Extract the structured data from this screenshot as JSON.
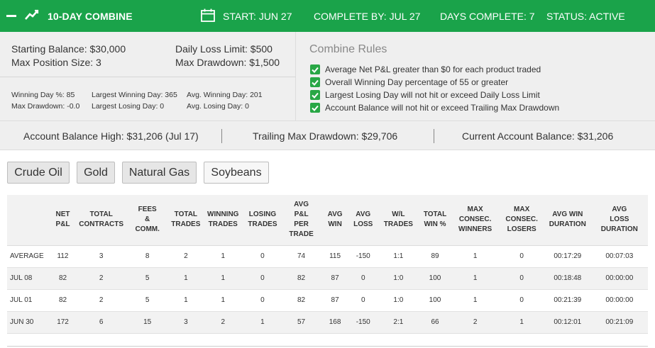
{
  "header": {
    "title": "10-DAY COMBINE",
    "start": "START: JUN 27",
    "complete_by": "COMPLETE BY: JUL 27",
    "days_complete": "DAYS COMPLETE: 7",
    "status": "STATUS: ACTIVE",
    "accent_color": "#1aa34a"
  },
  "summary": {
    "starting_balance": "Starting Balance: $30,000",
    "max_position_size": "Max Position Size: 3",
    "daily_loss_limit": "Daily Loss Limit: $500",
    "max_drawdown": "Max Drawdown: $1,500",
    "winning_day_pct": "Winning Day %: 85",
    "max_drawdown_small": "Max Drawdown: -0.0",
    "largest_winning_day": "Largest Winning Day: 365",
    "largest_losing_day": "Largest Losing Day: 0",
    "avg_winning_day": "Avg. Winning Day: 201",
    "avg_losing_day": "Avg. Losing Day: 0"
  },
  "rules": {
    "title": "Combine Rules",
    "items": [
      "Average Net P&L greater than $0 for each product traded",
      "Overall Winning Day percentage of 55 or greater",
      "Largest Losing Day will not hit or exceed Daily Loss Limit",
      "Account Balance will not hit or exceed Trailing Max Drawdown"
    ]
  },
  "balances": {
    "high": "Account Balance High: $31,206 (Jul 17)",
    "trailing": "Trailing Max Drawdown: $29,706",
    "current": "Current Account Balance: $31,206"
  },
  "products": [
    "Crude Oil",
    "Gold",
    "Natural Gas",
    "Soybeans"
  ],
  "table": {
    "headers": [
      "",
      "NET P&L",
      "TOTAL CONTRACTS",
      "FEES & COMM.",
      "TOTAL TRADES",
      "WINNING TRADES",
      "LOSING TRADES",
      "AVG P&L PER TRADE",
      "AVG WIN",
      "AVG LOSS",
      "W/L TRADES",
      "TOTAL WIN %",
      "MAX CONSEC. WINNERS",
      "MAX CONSEC. LOSERS",
      "AVG WIN DURATION",
      "AVG LOSS DURATION"
    ],
    "rows": [
      [
        "AVERAGE",
        "112",
        "3",
        "8",
        "2",
        "1",
        "0",
        "74",
        "115",
        "-150",
        "1:1",
        "89",
        "1",
        "0",
        "00:17:29",
        "00:07:03"
      ],
      [
        "JUL 08",
        "82",
        "2",
        "5",
        "1",
        "1",
        "0",
        "82",
        "87",
        "0",
        "1:0",
        "100",
        "1",
        "0",
        "00:18:48",
        "00:00:00"
      ],
      [
        "JUL 01",
        "82",
        "2",
        "5",
        "1",
        "1",
        "0",
        "82",
        "87",
        "0",
        "1:0",
        "100",
        "1",
        "0",
        "00:21:39",
        "00:00:00"
      ],
      [
        "JUN 30",
        "172",
        "6",
        "15",
        "3",
        "2",
        "1",
        "57",
        "168",
        "-150",
        "2:1",
        "66",
        "2",
        "1",
        "00:12:01",
        "00:21:09"
      ]
    ]
  }
}
